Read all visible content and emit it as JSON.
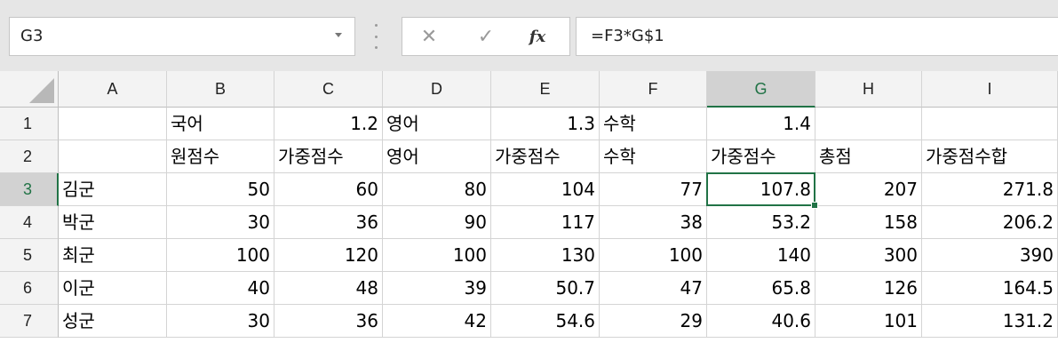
{
  "name_box": {
    "value": "G3"
  },
  "formula_bar": {
    "value": "=F3*G$1",
    "fx_label": "fx",
    "cancel_glyph": "✕",
    "enter_glyph": "✓"
  },
  "columns": [
    "A",
    "B",
    "C",
    "D",
    "E",
    "F",
    "G",
    "H",
    "I"
  ],
  "rows": [
    "1",
    "2",
    "3",
    "4",
    "5",
    "6",
    "7"
  ],
  "selected_cell": "G3",
  "accent_color": "#217346",
  "cells": {
    "B1": "국어",
    "C1": "1.2",
    "D1": "영어",
    "E1": "1.3",
    "F1": "수학",
    "G1": "1.4",
    "B2": "원점수",
    "C2": "가중점수",
    "D2": "영어",
    "E2": "가중점수",
    "F2": "수학",
    "G2": "가중점수",
    "H2": "총점",
    "I2": "가중점수합",
    "A3": "김군",
    "B3": "50",
    "C3": "60",
    "D3": "80",
    "E3": "104",
    "F3": "77",
    "G3": "107.8",
    "H3": "207",
    "I3": "271.8",
    "A4": "박군",
    "B4": "30",
    "C4": "36",
    "D4": "90",
    "E4": "117",
    "F4": "38",
    "G4": "53.2",
    "H4": "158",
    "I4": "206.2",
    "A5": "최군",
    "B5": "100",
    "C5": "120",
    "D5": "100",
    "E5": "130",
    "F5": "100",
    "G5": "140",
    "H5": "300",
    "I5": "390",
    "A6": "이군",
    "B6": "40",
    "C6": "48",
    "D6": "39",
    "E6": "50.7",
    "F6": "47",
    "G6": "65.8",
    "H6": "126",
    "I6": "164.5",
    "A7": "성군",
    "B7": "30",
    "C7": "36",
    "D7": "42",
    "E7": "54.6",
    "F7": "29",
    "G7": "40.6",
    "H7": "101",
    "I7": "131.2"
  }
}
